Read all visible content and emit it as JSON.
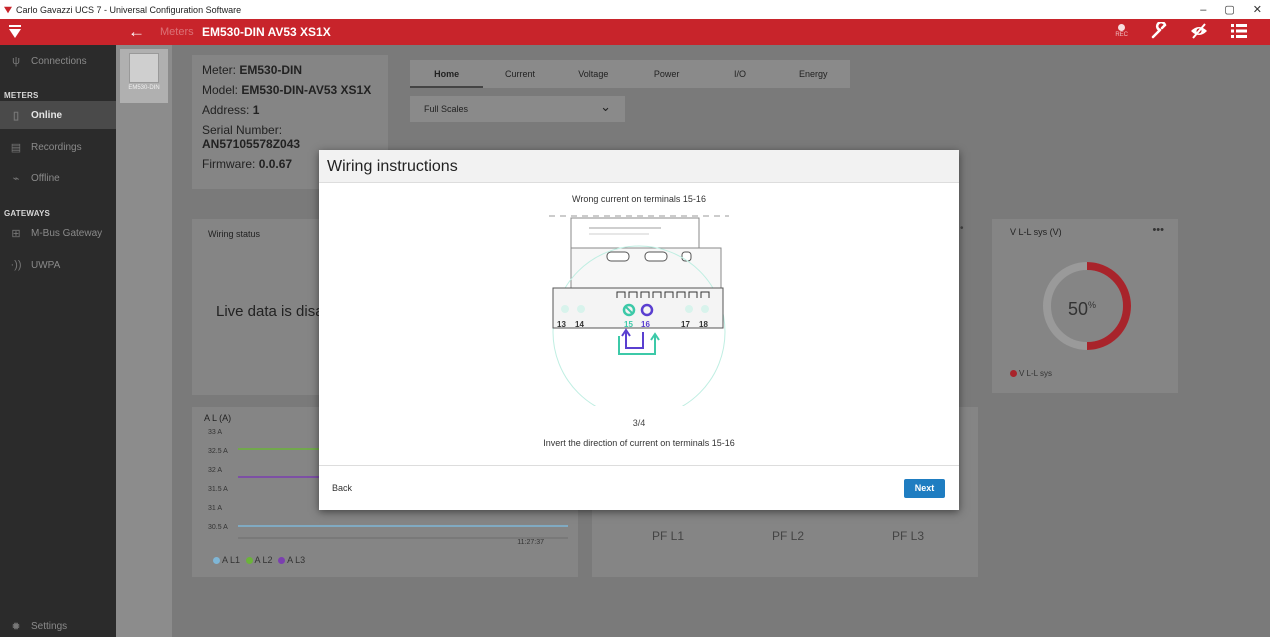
{
  "window": {
    "title": "Carlo Gavazzi UCS 7 - Universal Configuration Software",
    "controls": [
      "–",
      "▢",
      "✕"
    ]
  },
  "header": {
    "back_icon": "←",
    "breadcrumb": "Meters",
    "title": "EM530-DIN AV53 XS1X",
    "rec_label": "REC",
    "icons": [
      "rec-icon",
      "wrench-icon",
      "hide-icon",
      "list-icon"
    ]
  },
  "sidebar": {
    "connections": "Connections",
    "meters_section": "METERS",
    "online": "Online",
    "recordings": "Recordings",
    "offline": "Offline",
    "gateways_section": "GATEWAYS",
    "mbus": "M-Bus Gateway",
    "uwpa": "UWPA",
    "settings": "Settings"
  },
  "device": {
    "label": "EM530-DIN"
  },
  "meter_info": {
    "meter_label": "Meter:",
    "meter": "EM530-DIN",
    "model_label": "Model:",
    "model": "EM530-DIN-AV53 XS1X",
    "address_label": "Address:",
    "address": "1",
    "serial_label": "Serial Number:",
    "serial": "AN57105578Z043",
    "firmware_label": "Firmware:",
    "firmware": "0.0.67"
  },
  "tabs": [
    "Home",
    "Current",
    "Voltage",
    "Power",
    "I/O",
    "Energy"
  ],
  "select": {
    "value": "Full Scales"
  },
  "wiring_status": {
    "title": "Wiring status",
    "live_text": "Live data is disa"
  },
  "vll_card": {
    "title": "V L-L sys (V)",
    "menu": "•••",
    "percent": "50",
    "percent_sign": "%",
    "legend": "V L-L sys"
  },
  "al_card": {
    "title": "A L (A)",
    "y_ticks": [
      "33 A",
      "32.5 A",
      "32 A",
      "31.5 A",
      "31 A",
      "30.5 A"
    ],
    "time": "11:27:37",
    "legend": [
      "A L1",
      "A L2",
      "A L3"
    ]
  },
  "pf_card": {
    "labels": [
      "PF L1",
      "PF L2",
      "PF L3"
    ]
  },
  "modal": {
    "title": "Wiring instructions",
    "wrong": "Wrong current on terminals 15-16",
    "terminals_left": [
      "13",
      "14"
    ],
    "terminals_mid": [
      "15",
      "16"
    ],
    "terminals_right": [
      "17",
      "18"
    ],
    "step": "3/4",
    "instruction": "Invert the direction of current on terminals 15-16",
    "back": "Back",
    "next": "Next"
  },
  "colors": {
    "brand_red": "#c8242b",
    "accent_blue": "#1f7dc1",
    "teal": "#3cc9a8",
    "purple": "#5a3fd0",
    "line_green": "#6bb33a",
    "line_purple": "#7b3fb0",
    "line_blue": "#7fb6d6"
  }
}
